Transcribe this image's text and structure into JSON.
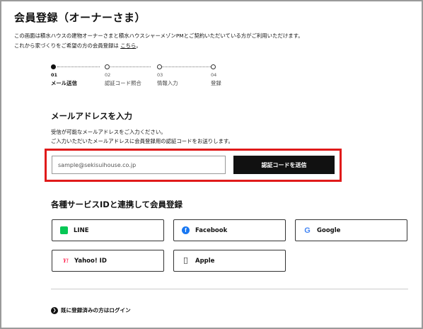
{
  "page": {
    "title": "会員登録（オーナーさま）",
    "intro_line1": "この画面は積水ハウスの建物オーナーさまと積水ハウスシャーメゾンPMとご契約いただいている方がご利用いただけます。",
    "intro_line2_prefix": "これから家づくりをご希望の方の会員登録は",
    "intro_link": "こちら",
    "intro_line2_suffix": "。"
  },
  "steps": [
    {
      "num": "01",
      "label": "メール送信",
      "active": true
    },
    {
      "num": "02",
      "label": "認証コード照合",
      "active": false
    },
    {
      "num": "03",
      "label": "情報入力",
      "active": false
    },
    {
      "num": "04",
      "label": "登録",
      "active": false
    }
  ],
  "email_section": {
    "heading": "メールアドレスを入力",
    "desc_line1": "受信が可能なメールアドレスをご入力ください。",
    "desc_line2": "ご入力いただいたメールアドレスに会員登録用の認証コードをお送りします。",
    "input_value": "sample@sekisuihouse.co.jp",
    "send_button": "認証コードを送信"
  },
  "social_section": {
    "heading": "各種サービスIDと連携して会員登録",
    "buttons": [
      {
        "label": "LINE",
        "icon": "line-icon"
      },
      {
        "label": "Facebook",
        "icon": "facebook-icon"
      },
      {
        "label": "Google",
        "icon": "google-icon"
      },
      {
        "label": "Yahoo! ID",
        "icon": "yahoo-icon"
      },
      {
        "label": "Apple",
        "icon": "apple-icon"
      }
    ]
  },
  "footer": {
    "login_link": "既に登録済みの方はログイン"
  },
  "colors": {
    "highlight": "#e01a1a",
    "line": "#06c755",
    "facebook": "#1877f2",
    "google": "#4285f4",
    "yahoo": "#ff0033"
  }
}
